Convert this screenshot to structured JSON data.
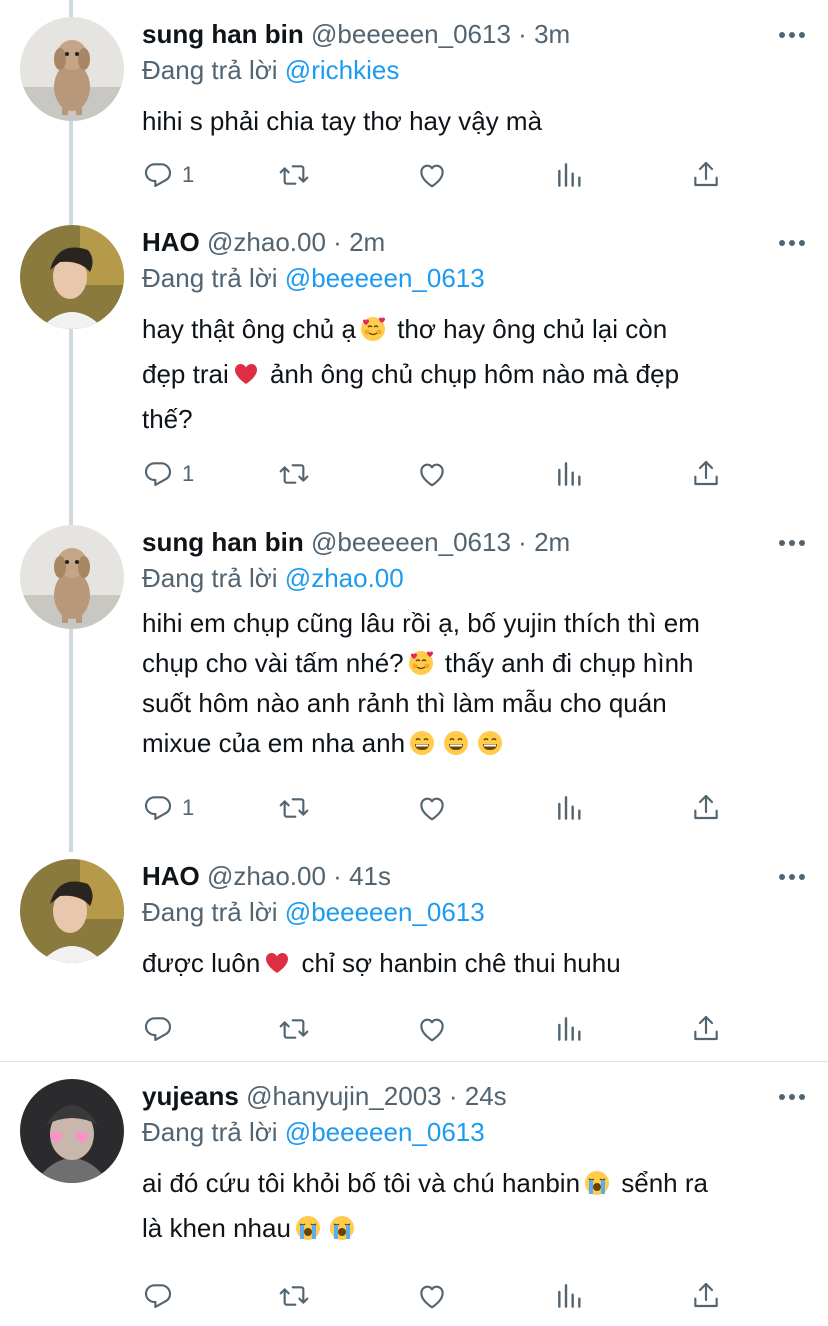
{
  "colors": {
    "accent": "#1d9bf0",
    "muted": "#536471",
    "text": "#0f1419",
    "heart": "#e0245e",
    "thread_line": "#cfd9de"
  },
  "icons": {
    "reply": "comment-bubble-icon",
    "retweet": "retweet-arrows-icon",
    "like": "heart-outline-icon",
    "views": "bar-chart-icon",
    "share": "upload-share-icon",
    "more": "three-dots-icon"
  },
  "replying_prefix": "Đang trả lời",
  "tweets": [
    {
      "name": "sung han bin",
      "handle": "@beeeeen_0613",
      "sep": "·",
      "time": "3m",
      "replying_to": "@richkies",
      "text": [
        "hihi s phải chia tay thơ hay vậy mà"
      ],
      "reply_count": "1"
    },
    {
      "name": "HAO",
      "handle": "@zhao.00",
      "sep": "·",
      "time": "2m",
      "replying_to": "@beeeeen_0613",
      "text": [
        "hay thật ông chủ ạ",
        "thơ hay ông chủ lại còn",
        "đẹp trai",
        "ảnh ông chủ chụp hôm nào mà đẹp",
        "thế?"
      ],
      "emoji": [
        "smiling-face-with-hearts",
        "red-heart"
      ],
      "reply_count": "1"
    },
    {
      "name": "sung han bin",
      "handle": "@beeeeen_0613",
      "sep": "·",
      "time": "2m",
      "replying_to": "@zhao.00",
      "text": [
        "hihi em chụp cũng lâu rồi ạ, bố yujin thích thì em",
        "chụp cho vài tấm nhé?",
        "thấy anh đi chụp hình",
        "suốt hôm nào anh rảnh thì làm mẫu cho quán",
        "mixue của em nha anh"
      ],
      "emoji": [
        "smiling-face-with-hearts",
        "grinning-face",
        "grinning-face",
        "grinning-face"
      ],
      "reply_count": "1"
    },
    {
      "name": "HAO",
      "handle": "@zhao.00",
      "sep": "·",
      "time": "41s",
      "replying_to": "@beeeeen_0613",
      "text": [
        "được luôn",
        "chỉ sợ hanbin chê thui huhu"
      ],
      "emoji": [
        "red-heart"
      ],
      "reply_count": ""
    },
    {
      "name": "yujeans",
      "handle": "@hanyujin_2003",
      "sep": "·",
      "time": "24s",
      "replying_to": "@beeeeen_0613",
      "text": [
        "ai đó cứu tôi khỏi bố tôi và chú hanbin",
        "sểnh ra",
        "là khen nhau"
      ],
      "emoji": [
        "loudly-crying-face",
        "loudly-crying-face",
        "loudly-crying-face"
      ],
      "reply_count": ""
    }
  ]
}
